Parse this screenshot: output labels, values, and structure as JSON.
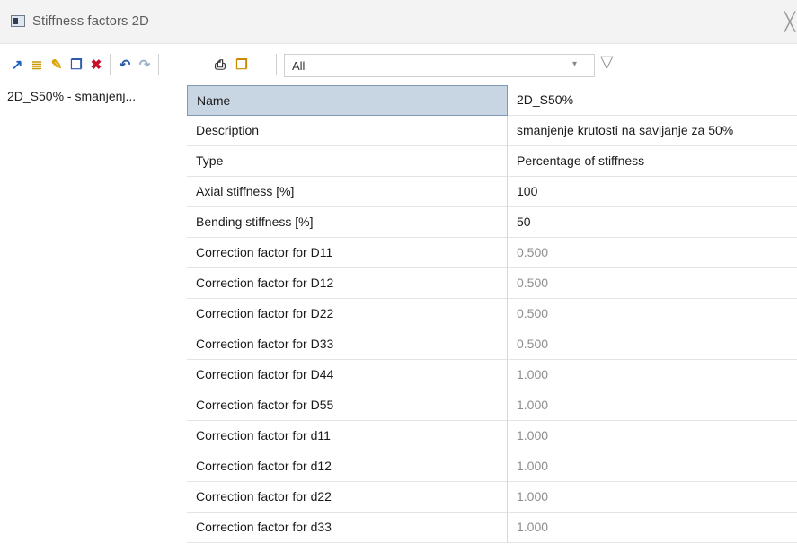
{
  "window": {
    "title": "Stiffness factors 2D"
  },
  "toolbar": {
    "icons": [
      "new-icon",
      "insert-icon",
      "edit-icon",
      "copy-icon",
      "delete-icon",
      "undo-icon",
      "redo-icon",
      "print-icon",
      "open-icon"
    ],
    "filter": {
      "selected": "All"
    }
  },
  "list": {
    "items": [
      "2D_S50% - smanjenj..."
    ]
  },
  "properties": [
    {
      "name": "Name",
      "value": "2D_S50%",
      "dim": false
    },
    {
      "name": "Description",
      "value": "smanjenje krutosti na savijanje za 50%",
      "dim": false
    },
    {
      "name": "Type",
      "value": "Percentage of stiffness",
      "dim": false
    },
    {
      "name": "Axial stiffness [%]",
      "value": "100",
      "dim": false
    },
    {
      "name": "Bending stiffness [%]",
      "value": "50",
      "dim": false
    },
    {
      "name": "Correction factor for D11",
      "value": "0.500",
      "dim": true
    },
    {
      "name": "Correction factor for D12",
      "value": "0.500",
      "dim": true
    },
    {
      "name": "Correction factor for D22",
      "value": "0.500",
      "dim": true
    },
    {
      "name": "Correction factor for D33",
      "value": "0.500",
      "dim": true
    },
    {
      "name": "Correction factor for D44",
      "value": "1.000",
      "dim": true
    },
    {
      "name": "Correction factor for D55",
      "value": "1.000",
      "dim": true
    },
    {
      "name": "Correction factor for d11",
      "value": "1.000",
      "dim": true
    },
    {
      "name": "Correction factor for d12",
      "value": "1.000",
      "dim": true
    },
    {
      "name": "Correction factor for d22",
      "value": "1.000",
      "dim": true
    },
    {
      "name": "Correction factor for d33",
      "value": "1.000",
      "dim": true
    }
  ]
}
